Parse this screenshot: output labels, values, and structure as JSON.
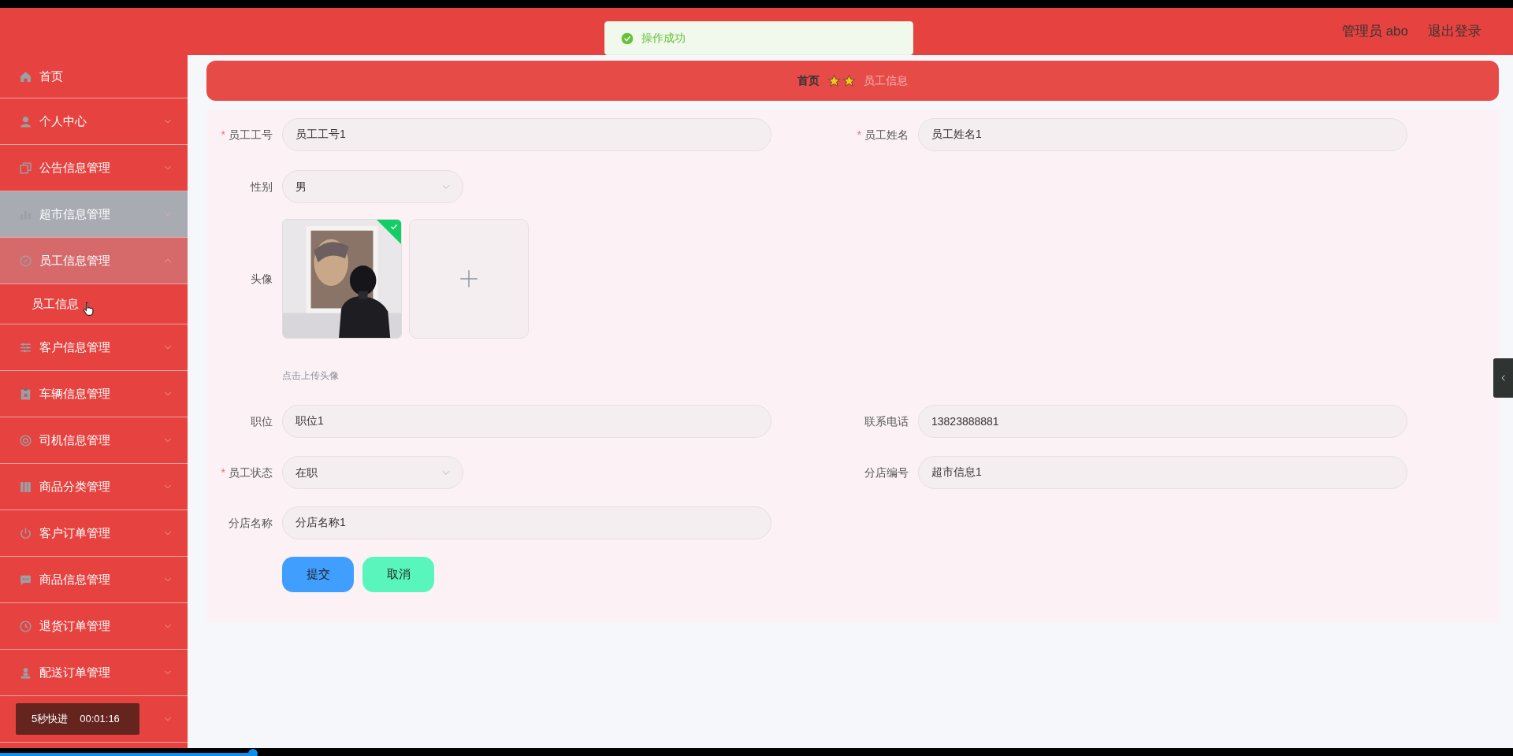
{
  "header": {
    "user": "管理员 abo",
    "logout": "退出登录"
  },
  "toast": {
    "message": "操作成功"
  },
  "sidebar": {
    "items": [
      {
        "label": "首页",
        "expandable": false,
        "expanded": false,
        "hovered": false
      },
      {
        "label": "个人中心",
        "expandable": true,
        "expanded": false,
        "hovered": false
      },
      {
        "label": "公告信息管理",
        "expandable": true,
        "expanded": false,
        "hovered": false
      },
      {
        "label": "超市信息管理",
        "expandable": true,
        "expanded": false,
        "hovered": true
      },
      {
        "label": "员工信息管理",
        "expandable": true,
        "expanded": true,
        "hovered": false,
        "children": [
          {
            "label": "员工信息"
          }
        ]
      },
      {
        "label": "客户信息管理",
        "expandable": true,
        "expanded": false,
        "hovered": false
      },
      {
        "label": "车辆信息管理",
        "expandable": true,
        "expanded": false,
        "hovered": false
      },
      {
        "label": "司机信息管理",
        "expandable": true,
        "expanded": false,
        "hovered": false
      },
      {
        "label": "商品分类管理",
        "expandable": true,
        "expanded": false,
        "hovered": false
      },
      {
        "label": "客户订单管理",
        "expandable": true,
        "expanded": false,
        "hovered": false
      },
      {
        "label": "商品信息管理",
        "expandable": true,
        "expanded": false,
        "hovered": false
      },
      {
        "label": "退货订单管理",
        "expandable": true,
        "expanded": false,
        "hovered": false
      },
      {
        "label": "配送订单管理",
        "expandable": true,
        "expanded": false,
        "hovered": false
      }
    ]
  },
  "breadcrumb": [
    "首页",
    "员工信息"
  ],
  "form": {
    "rows": [
      {
        "kind": "pair",
        "fields": [
          {
            "label": "员工工号",
            "required_mark": "*",
            "value": "员工工号1",
            "kind": "text"
          },
          {
            "label": "员工姓名",
            "required_mark": "*",
            "value": "员工姓名1",
            "kind": "text"
          }
        ]
      },
      {
        "kind": "pair",
        "fields": [
          {
            "label": "性别",
            "value": "男",
            "kind": "select"
          }
        ]
      },
      {
        "kind": "upload",
        "label": "头像",
        "hint": "点击上传头像",
        "uploaded": true
      },
      {
        "kind": "pair",
        "fields": [
          {
            "label": "职位",
            "value": "职位1",
            "kind": "text"
          },
          {
            "label": "联系电话",
            "value": "13823888881",
            "kind": "text"
          }
        ]
      },
      {
        "kind": "pair",
        "fields": [
          {
            "label": "员工状态",
            "required_mark": "*",
            "value": "在职",
            "kind": "select"
          },
          {
            "label": "分店编号",
            "value": "超市信息1",
            "kind": "text"
          }
        ]
      },
      {
        "kind": "pair",
        "fields": [
          {
            "label": "分店名称",
            "value": "分店名称1",
            "kind": "text"
          }
        ]
      }
    ],
    "buttons": [
      {
        "label": "提交",
        "kind": "primary"
      },
      {
        "label": "取消",
        "kind": "secondary"
      }
    ]
  },
  "player": {
    "action": "5秒快进",
    "time": "00:01:16",
    "level": 0.167
  }
}
